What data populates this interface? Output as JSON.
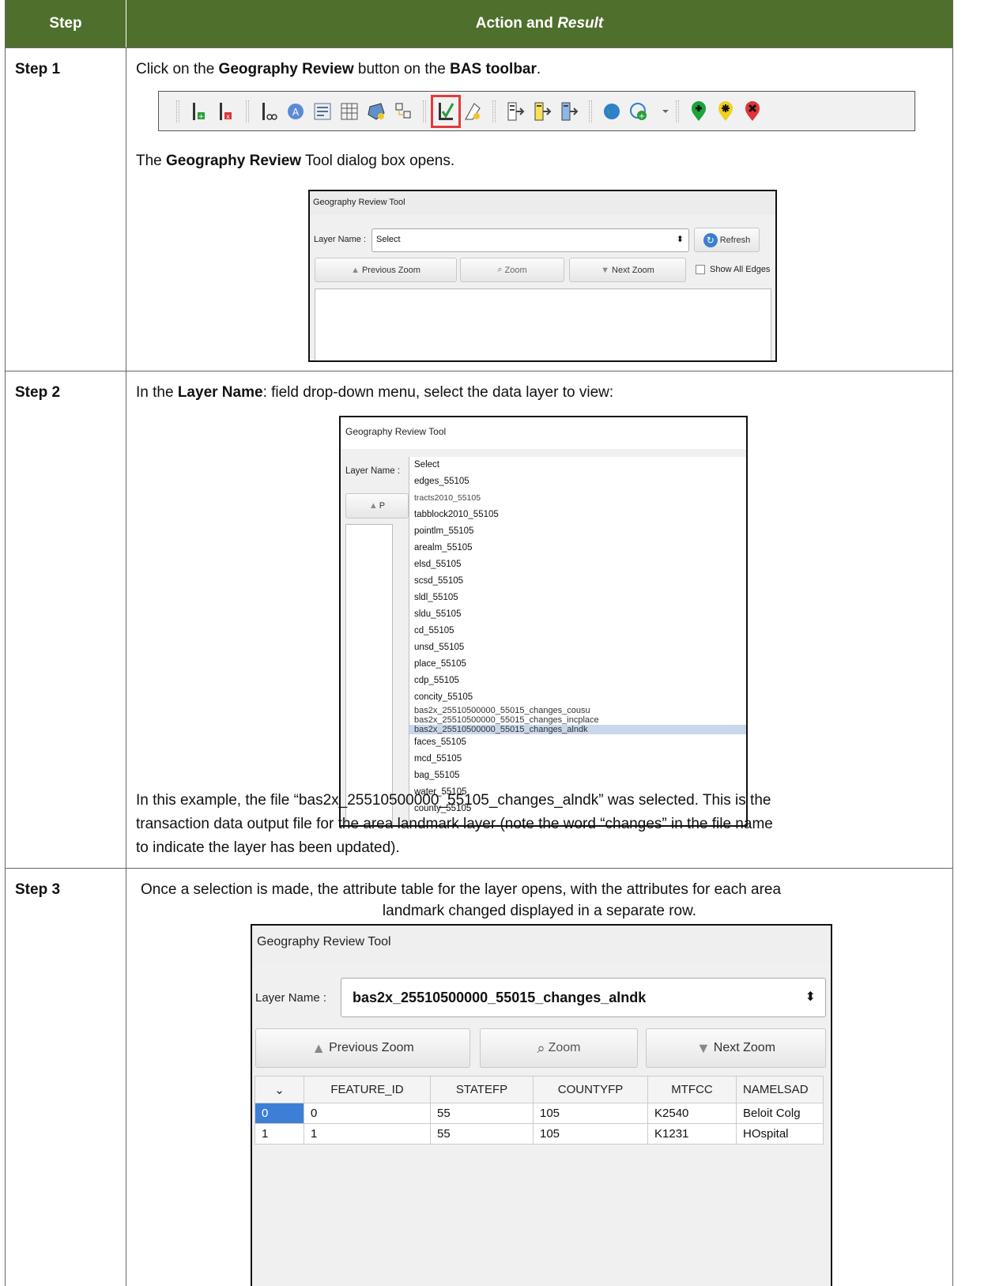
{
  "header": {
    "col_step": "Step",
    "col_action_plain": "Action and ",
    "col_action_italic": "Result"
  },
  "steps": [
    {
      "label": "Step 1",
      "line1_pre": "Click on the ",
      "line1_bold1": "Geography Review",
      "line1_mid": " button on the ",
      "line1_bold2": "BAS toolbar",
      "line1_post": ".",
      "line2_pre": "The ",
      "line2_bold": "Geography Review",
      "line2_post": " Tool dialog box opens.",
      "toolbar_icons": [
        "add-line-icon",
        "delete-line-icon",
        "split-line-icon",
        "identify-address-icon",
        "form-icon",
        "table-edit-icon",
        "polygon-tool-icon",
        "topology-icon",
        "geography-review-icon",
        "area-landmark-icon",
        "export-icon",
        "export-yellow-icon",
        "export-blue-icon",
        "globe-icon",
        "add-globe-icon",
        "add-point-icon",
        "move-point-icon",
        "delete-point-icon"
      ],
      "dialog": {
        "title": "Geography Review Tool",
        "layer_label": "Layer Name :",
        "layer_value": "Select",
        "refresh": "Refresh",
        "prev_zoom": "Previous Zoom",
        "zoom": "Zoom",
        "next_zoom": "Next Zoom",
        "show_all_edges": "Show All Edges"
      }
    },
    {
      "label": "Step 2",
      "line1_pre": "In the ",
      "line1_bold": "Layer Name",
      "line1_post": ": field drop-down menu, select the data layer to view:",
      "dialog": {
        "title": "Geography Review Tool",
        "layer_label": "Layer Name :",
        "items": [
          "Select",
          "edges_55105",
          "tracts2010_55105",
          "tabblock2010_55105",
          "pointlm_55105",
          "arealm_55105",
          "elsd_55105",
          "scsd_55105",
          "sldl_55105",
          "sldu_55105",
          "cd_55105",
          "unsd_55105",
          "place_55105",
          "cdp_55105",
          "concity_55105",
          "bas2x_25510500000_55015_changes_cousu",
          "bas2x_25510500000_55015_changes_incplace",
          "bas2x_25510500000_55015_changes_alndk",
          "faces_55105",
          "mcd_55105",
          "bag_55105",
          "water_55105",
          "county_55105"
        ]
      },
      "para": [
        "In this example, the file “bas2x_25510500000_55105_changes_alndk” was selected. This is the",
        "transaction data output file for the area landmark layer (note the word “changes” in the file name",
        "to indicate the layer has been updated)."
      ]
    },
    {
      "label": "Step 3",
      "line1": "Once a selection is made, the attribute table for the layer opens, with the attributes for each area",
      "line2": "landmark changed displayed in a separate row.",
      "dialog": {
        "title": "Geography Review Tool",
        "layer_label": "Layer Name :",
        "layer_value": "bas2x_25510500000_55015_changes_alndk",
        "prev_zoom": "Previous Zoom",
        "zoom": "Zoom",
        "next_zoom": "Next Zoom",
        "columns": [
          "FEATURE_ID",
          "STATEFP",
          "COUNTYFP",
          "MTFCC",
          "NAMELSAD"
        ],
        "rows": [
          {
            "idx": "0",
            "cells": [
              "0",
              "55",
              "105",
              "K2540",
              "Beloit Colg"
            ]
          },
          {
            "idx": "1",
            "cells": [
              "1",
              "55",
              "105",
              "K1231",
              "HOspital"
            ]
          }
        ]
      }
    }
  ],
  "colors": {
    "header_bg": "#4f6f2c",
    "highlight": "#e03c3c",
    "selection": "#c8d7ec"
  }
}
